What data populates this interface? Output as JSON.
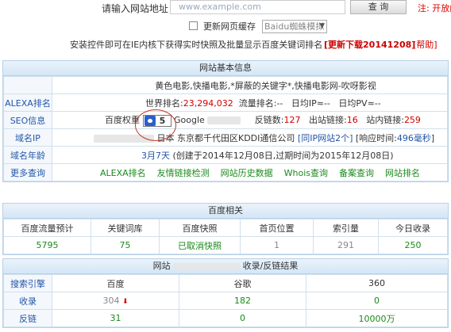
{
  "top": {
    "url_label": "请输入网站地址：",
    "url_value": "www.example.com",
    "query_button": "查 询",
    "note": "注: 开放内"
  },
  "options": {
    "update_cache_label": "更新网页缓存",
    "spider_select": "Baidu蜘蛛模拟"
  },
  "install_bar": {
    "text": "安装控件即可在IE内核下获得实时快照及批量显示百度关键词排名",
    "download": "[更新下载20141208]",
    "help": "[帮助]"
  },
  "basic": {
    "title": "网站基本信息",
    "site_title": "黄色电影,快播电影,*屏蔽的关键字*,快播电影网-吹呀影视",
    "alexa_label": "ALEXA排名",
    "world_rank_label": "世界排名:",
    "world_rank": "23,294,032",
    "traffic_rank": "流量排名:--",
    "daily_ip": "日均IP≈--",
    "daily_pv": "日均PV≈--",
    "seo_label": "SEO信息",
    "baidu_weight_label": "百度权重",
    "baidu_weight": "5",
    "google_label": "Google",
    "backlinks_label": "反链数:",
    "backlinks": "127",
    "outbound_label": "出站链接:",
    "outbound": "16",
    "internal_label": "站内链接:",
    "internal": "259",
    "ip_label": "域名IP",
    "ip_location": "日本 东京都千代田区KDDI通信公司",
    "same_ip": "[同IP网站2个]",
    "response_label": "[响应时间:",
    "response": "496毫秒",
    "response_end": "]",
    "age_label": "域名年龄",
    "age_value": "3月7天",
    "age_detail": "(创建于2014年12月08日,过期时间为2015年12月08日)",
    "more_label": "更多查询",
    "more_links": [
      "ALEXA排名",
      "友情链接检测",
      "网站历史数据",
      "Whois查询",
      "备案查询",
      "网站排名"
    ]
  },
  "baidu": {
    "title": "百度相关",
    "headers": [
      "百度流量预计",
      "关键词库",
      "百度快照",
      "首页位置",
      "索引量",
      "今日收录"
    ],
    "values": [
      "5795",
      "75",
      "已取消快照",
      "1",
      "291",
      "250"
    ]
  },
  "results": {
    "title_prefix": "网站",
    "title_suffix": "收录/反链结果",
    "headers": [
      "搜索引擎",
      "百度",
      "谷歌",
      "360"
    ],
    "rows": [
      {
        "label": "收录",
        "baidu": "304",
        "google": "182",
        "so360": "0"
      },
      {
        "label": "反链",
        "baidu": "31",
        "google": "0",
        "so360": "10000万"
      }
    ]
  },
  "colors": {
    "accent_blue": "#2255aa",
    "accent_red": "#d00000",
    "accent_green": "#1a8a1a"
  }
}
